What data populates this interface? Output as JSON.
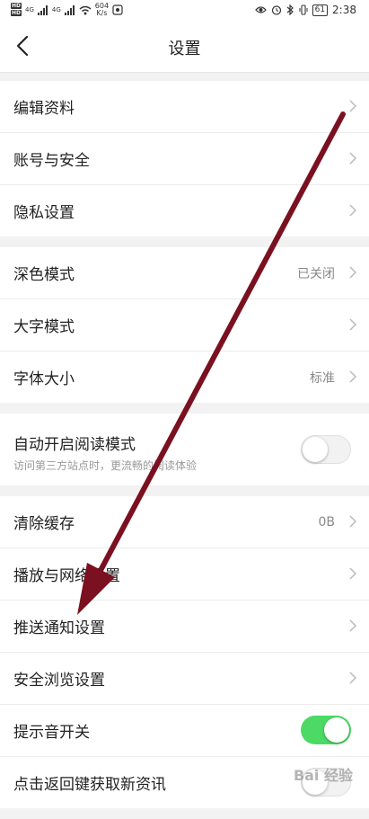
{
  "status_bar": {
    "hd1": "HD",
    "hd2": "HD",
    "net1": "4G",
    "net2": "4G",
    "speed_value": "604",
    "speed_unit": "K/s",
    "battery": "61",
    "time": "2:38"
  },
  "header": {
    "title": "设置"
  },
  "groups": [
    {
      "items": [
        {
          "label": "编辑资料"
        },
        {
          "label": "账号与安全"
        },
        {
          "label": "隐私设置"
        }
      ]
    },
    {
      "items": [
        {
          "label": "深色模式",
          "value": "已关闭"
        },
        {
          "label": "大字模式"
        },
        {
          "label": "字体大小",
          "value": "标准"
        }
      ]
    },
    {
      "items": [
        {
          "label": "自动开启阅读模式",
          "subtitle": "访问第三方站点时，更流畅的阅读体验",
          "toggle": "off"
        }
      ]
    },
    {
      "items": [
        {
          "label": "清除缓存",
          "value": "0B"
        },
        {
          "label": "播放与网络设置"
        },
        {
          "label": "推送通知设置"
        },
        {
          "label": "安全浏览设置"
        },
        {
          "label": "提示音开关",
          "toggle": "on"
        },
        {
          "label": "点击返回键获取新资讯",
          "toggle": "off"
        }
      ]
    }
  ],
  "colors": {
    "toggle_on": "#4cd964",
    "annotation_arrow": "#7a1020"
  },
  "watermark": "Bai 经验"
}
